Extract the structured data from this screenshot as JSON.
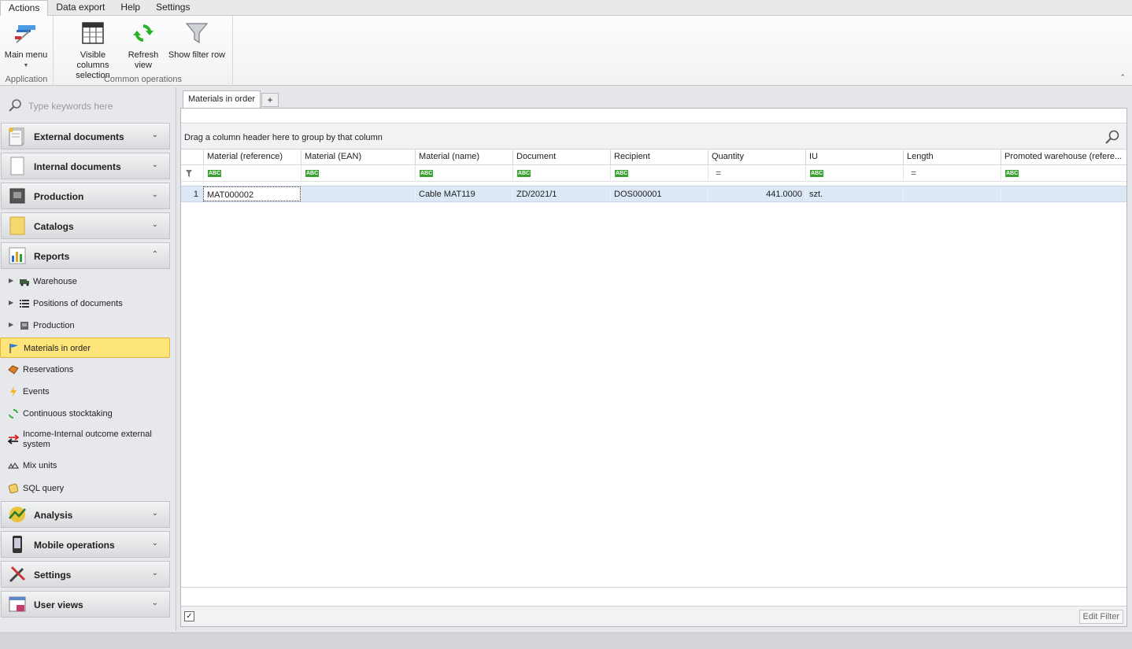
{
  "ribbon": {
    "tabs": [
      "Actions",
      "Data export",
      "Help",
      "Settings"
    ],
    "groups": {
      "application": {
        "label": "Application",
        "main_menu": "Main menu"
      },
      "common": {
        "label": "Common operations",
        "visible_columns_line1": "Visible columns",
        "visible_columns_line2": "selection",
        "refresh_line1": "Refresh",
        "refresh_line2": "view",
        "show_filter_row": "Show filter row"
      }
    }
  },
  "search": {
    "placeholder": "Type keywords here"
  },
  "nav": {
    "groups": {
      "external": "External documents",
      "internal": "Internal documents",
      "production": "Production",
      "catalogs": "Catalogs",
      "reports": "Reports",
      "analysis": "Analysis",
      "mobile": "Mobile operations",
      "settings": "Settings",
      "user_views": "User views"
    },
    "report_items": {
      "warehouse": "Warehouse",
      "positions": "Positions of documents",
      "production": "Production",
      "materials_in_order": "Materials in order",
      "reservations": "Reservations",
      "events": "Events",
      "stocktaking": "Continuous stocktaking",
      "income_line1": "Income-Internal outcome external",
      "income_line2": "system",
      "mix_units": "Mix units",
      "sql_query": "SQL query"
    }
  },
  "doc_tab": {
    "label": "Materials in order",
    "add": "+"
  },
  "grid": {
    "group_panel": "Drag a column header here to group by that column",
    "columns": {
      "c1": "Material (reference)",
      "c2": "Material (EAN)",
      "c3": "Material (name)",
      "c4": "Document",
      "c5": "Recipient",
      "c6": "Quantity",
      "c7": "IU",
      "c8": "Length",
      "c9": "Promoted warehouse (refere..."
    },
    "filter_abc": "ABC",
    "filter_eq": "=",
    "row": {
      "num": "1",
      "ref": "MAT000002",
      "ean": "",
      "name": "Cable MAT119",
      "document": "ZD/2021/1",
      "recipient": "DOS000001",
      "quantity": "441.0000",
      "iu": "szt.",
      "length": "",
      "promoted": ""
    },
    "edit_filter": "Edit Filter",
    "check": "✓"
  }
}
